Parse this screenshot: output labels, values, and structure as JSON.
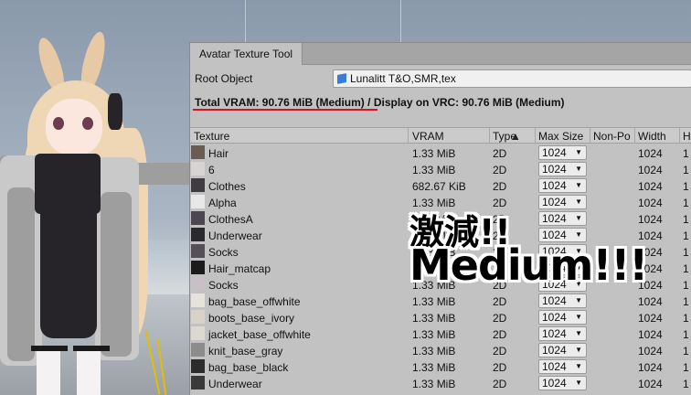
{
  "window": {
    "tab_label": "Avatar Texture Tool"
  },
  "root": {
    "label": "Root Object",
    "value": "Lunalitt T&O,SMR,tex"
  },
  "vram": {
    "total": "Total VRAM: 90.76 MiB (Medium)",
    "sep": " / ",
    "display": "Display on VRC: 90.76 MiB (Medium)"
  },
  "columns": [
    "Texture",
    "VRAM",
    "Type",
    "Max Size",
    "Non-Po",
    "Width",
    "H"
  ],
  "rows": [
    {
      "name": "Hair",
      "vram": "1.33 MiB",
      "type": "2D",
      "max": "1024",
      "width": "1024",
      "h": "1"
    },
    {
      "name": "6",
      "vram": "1.33 MiB",
      "type": "2D",
      "max": "1024",
      "width": "1024",
      "h": "1"
    },
    {
      "name": "Clothes",
      "vram": "682.67 KiB",
      "type": "2D",
      "max": "1024",
      "width": "1024",
      "h": "1"
    },
    {
      "name": "Alpha",
      "vram": "1.33 MiB",
      "type": "2D",
      "max": "1024",
      "width": "1024",
      "h": "1"
    },
    {
      "name": "ClothesA",
      "vram": "1.33 MiB",
      "type": "2D",
      "max": "1024",
      "width": "1024",
      "h": "1"
    },
    {
      "name": "Underwear",
      "vram": "1.33 MiB",
      "type": "2D",
      "max": "1024",
      "width": "1024",
      "h": "1"
    },
    {
      "name": "Socks",
      "vram": "1.33 MiB",
      "type": "2D",
      "max": "1024",
      "width": "1024",
      "h": "1"
    },
    {
      "name": "Hair_matcap",
      "vram": "1.33 MiB",
      "type": "2D",
      "max": "1024",
      "width": "1024",
      "h": "1"
    },
    {
      "name": "Socks",
      "vram": "1.33 MiB",
      "type": "2D",
      "max": "1024",
      "width": "1024",
      "h": "1"
    },
    {
      "name": "bag_base_offwhite",
      "vram": "1.33 MiB",
      "type": "2D",
      "max": "1024",
      "width": "1024",
      "h": "1"
    },
    {
      "name": "boots_base_ivory",
      "vram": "1.33 MiB",
      "type": "2D",
      "max": "1024",
      "width": "1024",
      "h": "1"
    },
    {
      "name": "jacket_base_offwhite",
      "vram": "1.33 MiB",
      "type": "2D",
      "max": "1024",
      "width": "1024",
      "h": "1"
    },
    {
      "name": "knit_base_gray",
      "vram": "1.33 MiB",
      "type": "2D",
      "max": "1024",
      "width": "1024",
      "h": "1"
    },
    {
      "name": "bag_base_black",
      "vram": "1.33 MiB",
      "type": "2D",
      "max": "1024",
      "width": "1024",
      "h": "1"
    },
    {
      "name": "Underwear",
      "vram": "1.33 MiB",
      "type": "2D",
      "max": "1024",
      "width": "1024",
      "h": "1"
    }
  ],
  "overlay": {
    "line1": "激減!!",
    "line2": "Medium!!!"
  },
  "colors": {
    "highlight_underline": "#e0101a",
    "panel_bg": "#c2c2c2"
  },
  "icons": {
    "root_object": "cube-icon",
    "dropdown": "caret-down-icon",
    "sort": "sort-asc-icon"
  }
}
